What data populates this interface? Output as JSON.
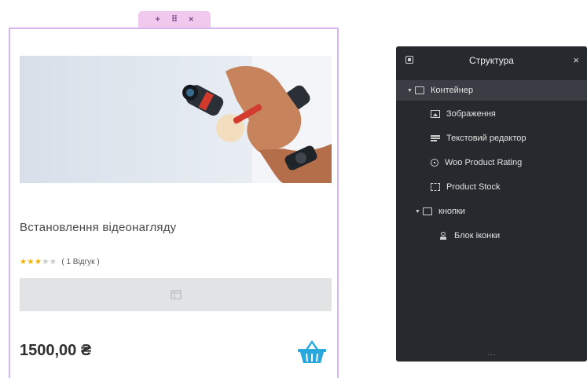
{
  "widget_toolbar": {
    "add_label": "+",
    "move_label": "⠿",
    "close_label": "×"
  },
  "product": {
    "image_alt": "Installation of a security camera",
    "title": "Встановлення відеонагляду",
    "rating": {
      "value": 3,
      "max": 5,
      "reviews_text": "( 1 Відгук )"
    },
    "price": "1500,00 ₴",
    "basket_icon": "basket-icon"
  },
  "structure_panel": {
    "title": "Структура",
    "close_label": "×",
    "footer_label": "...",
    "items": [
      {
        "label": "Контейнер",
        "icon": "container-icon",
        "level": 0,
        "caret": "▼",
        "selected": true
      },
      {
        "label": "Зображення",
        "icon": "image-icon",
        "level": 1,
        "caret": "",
        "selected": false
      },
      {
        "label": "Текстовий редактор",
        "icon": "text-editor-icon",
        "level": 1,
        "caret": "",
        "selected": false
      },
      {
        "label": "Woo Product Rating",
        "icon": "rating-icon",
        "level": 1,
        "caret": "",
        "selected": false
      },
      {
        "label": "Product Stock",
        "icon": "stock-icon",
        "level": 1,
        "caret": "",
        "selected": false
      },
      {
        "label": "кнопки",
        "icon": "container-icon",
        "level": 1,
        "caret": "▼",
        "selected": false
      },
      {
        "label": "Блок іконки",
        "icon": "icon-box-icon",
        "level": 2,
        "caret": "",
        "selected": false
      }
    ]
  },
  "colors": {
    "card_border": "#d9b6f2",
    "toolbar_bg": "#f2c9ee",
    "panel_bg": "#26292d",
    "star": "#f3b100",
    "basket": "#28a8dc"
  }
}
